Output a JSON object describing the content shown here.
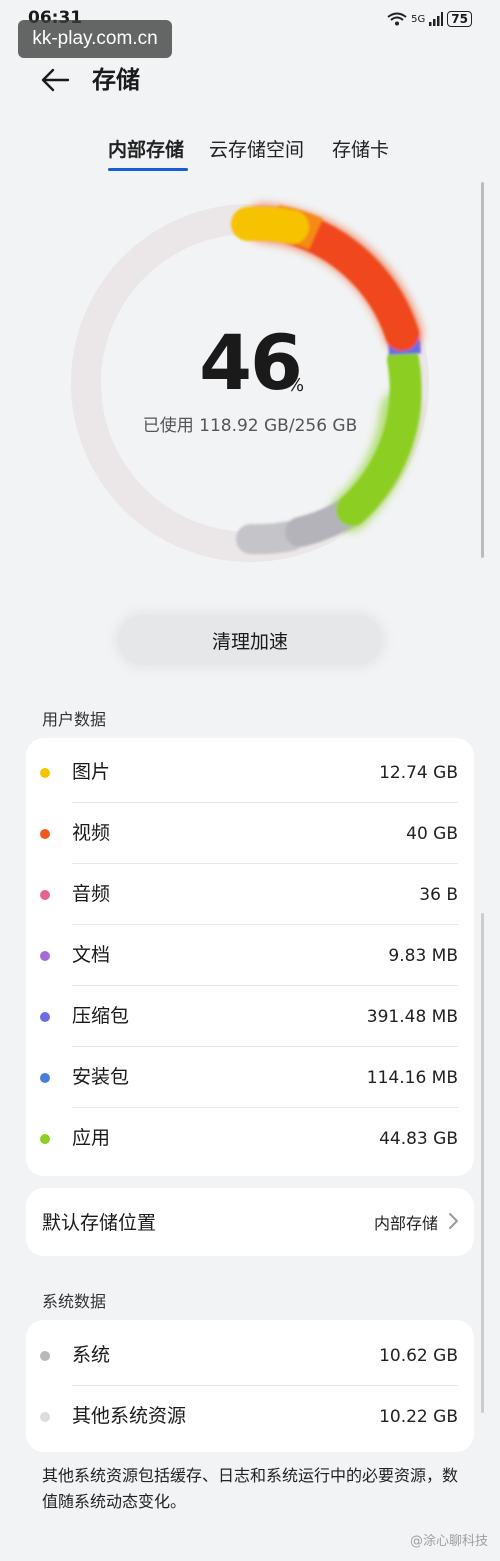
{
  "status_bar": {
    "time": "06:31",
    "signal": "5G",
    "battery": "75"
  },
  "watermark": "kk-play.com.cn",
  "header": {
    "title": "存储"
  },
  "tabs": [
    {
      "label": "内部存储",
      "active": true
    },
    {
      "label": "云存储空间",
      "active": false
    },
    {
      "label": "存储卡",
      "active": false
    }
  ],
  "usage": {
    "percent": "46",
    "percent_sign": "%",
    "used_text": "已使用 118.92 GB/256 GB"
  },
  "clean_button": "清理加速",
  "user_data": {
    "label": "用户数据",
    "items": [
      {
        "name": "图片",
        "size": "12.74 GB",
        "color": "#f5c400"
      },
      {
        "name": "视频",
        "size": "40 GB",
        "color": "#f05a22"
      },
      {
        "name": "音频",
        "size": "36 B",
        "color": "#e8648c"
      },
      {
        "name": "文档",
        "size": "9.83 MB",
        "color": "#a76bd8"
      },
      {
        "name": "压缩包",
        "size": "391.48 MB",
        "color": "#6b6de0"
      },
      {
        "name": "安装包",
        "size": "114.16 MB",
        "color": "#4a7de0"
      },
      {
        "name": "应用",
        "size": "44.83 GB",
        "color": "#8ccf22"
      }
    ]
  },
  "default_location": {
    "label": "默认存储位置",
    "value": "内部存储"
  },
  "system_data": {
    "label": "系统数据",
    "items": [
      {
        "name": "系统",
        "size": "10.62 GB",
        "color": "#b9b9bd"
      },
      {
        "name": "其他系统资源",
        "size": "10.22 GB",
        "color": "#dcdcdf"
      }
    ]
  },
  "note": "其他系统资源包括缓存、日志和系统运行中的必要资源，数值随系统动态变化。",
  "corner_watermark": "@涂心聊科技"
}
